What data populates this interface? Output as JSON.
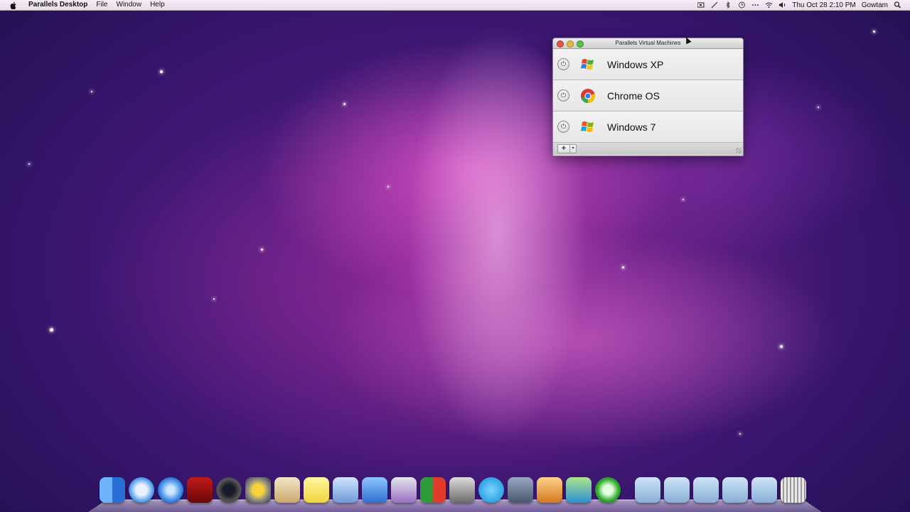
{
  "menubar": {
    "app_name": "Parallels Desktop",
    "menus": [
      "File",
      "Window",
      "Help"
    ],
    "clock": "Thu Oct 28  2:10 PM",
    "user": "Gowtam"
  },
  "window": {
    "title": "Parallels Virtual Machines",
    "vms": [
      {
        "name": "Windows XP",
        "icon": "windows-xp-icon"
      },
      {
        "name": "Chrome OS",
        "icon": "chrome-icon"
      },
      {
        "name": "Windows 7",
        "icon": "windows-7-icon"
      }
    ],
    "add_label": "+",
    "add_menu_label": "▾"
  },
  "dock": {
    "apps": [
      "finder-icon",
      "safari-icon",
      "itunes-icon",
      "photo-booth-icon",
      "camera-icon",
      "imovie-icon",
      "preview-icon",
      "stickies-icon",
      "mail-icon",
      "xcode-icon",
      "imac-icon",
      "parallels-icon",
      "movie-icon",
      "skype-icon",
      "script-editor-icon",
      "keynote-icon",
      "numbers-icon",
      "utorrent-icon"
    ],
    "folders": [
      "applications-folder-icon",
      "downloads-folder-icon",
      "documents-folder-icon",
      "folder-icon",
      "folder-icon",
      "trash-icon"
    ]
  }
}
